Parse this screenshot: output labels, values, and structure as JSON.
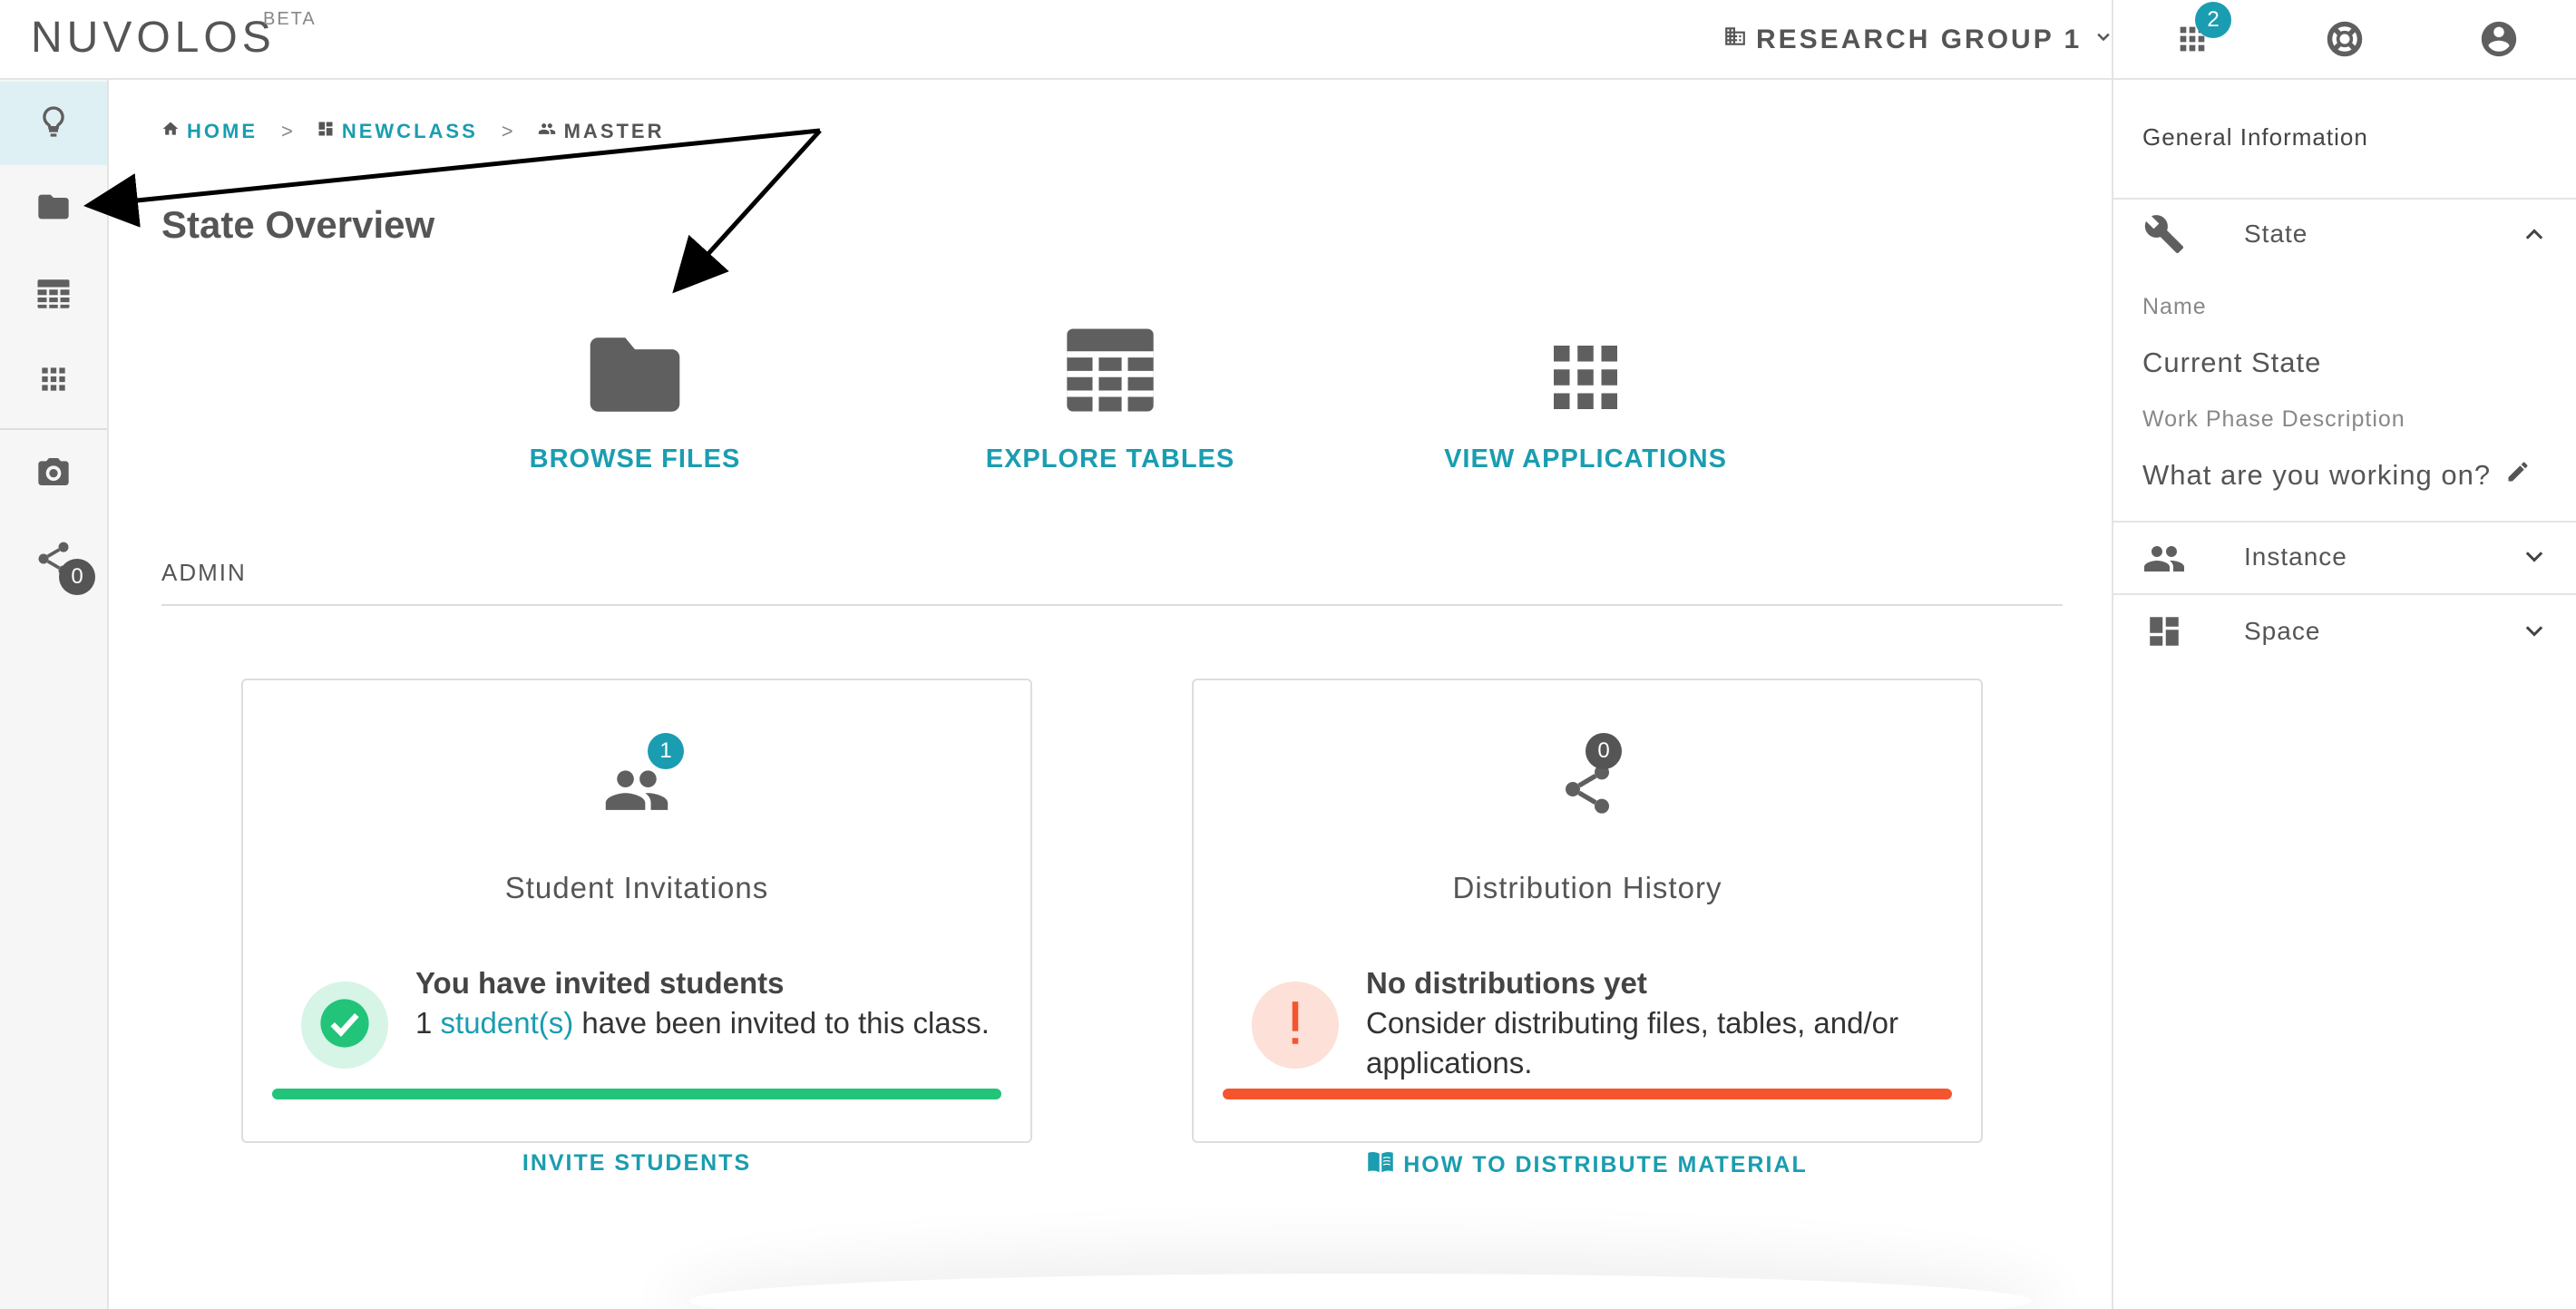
{
  "app": {
    "name": "NUVOLOS",
    "badge": "BETA"
  },
  "topbar": {
    "org_name": "RESEARCH GROUP 1",
    "apps_badge": "2",
    "icons": [
      "building-icon",
      "apps-grid-icon",
      "lifebuoy-icon",
      "account-circle-icon"
    ]
  },
  "sidebar": {
    "items": [
      {
        "icon": "lightbulb-icon",
        "active": true
      },
      {
        "icon": "folder-icon",
        "active": false
      },
      {
        "icon": "table-icon",
        "active": false
      },
      {
        "icon": "apps-grid-icon",
        "active": false
      },
      {
        "icon": "camera-icon",
        "active": false
      },
      {
        "icon": "share-icon",
        "active": false,
        "badge": "0"
      }
    ]
  },
  "breadcrumb": {
    "items": [
      {
        "label": "HOME",
        "icon": "home-icon"
      },
      {
        "label": "NEWCLASS",
        "icon": "space-icon"
      },
      {
        "label": "MASTER",
        "icon": "people-icon"
      }
    ],
    "separator": ">"
  },
  "main": {
    "title": "State Overview",
    "quick_links": [
      {
        "label": "BROWSE FILES",
        "icon": "folder-icon"
      },
      {
        "label": "EXPLORE TABLES",
        "icon": "table-icon"
      },
      {
        "label": "VIEW APPLICATIONS",
        "icon": "apps-grid-icon"
      }
    ],
    "admin_label": "ADMIN",
    "cards": [
      {
        "title": "Student Invitations",
        "badge": "1",
        "status_title": "You have invited students",
        "status_prefix": "1 ",
        "status_link": "student(s)",
        "status_suffix": " have been invited to this class.",
        "action": "INVITE STUDENTS",
        "status_color": "#22c47a"
      },
      {
        "title": "Distribution History",
        "badge": "0",
        "status_title": "No distributions yet",
        "status_text": "Consider distributing files, tables, and/or applications.",
        "action": "HOW TO DISTRIBUTE MATERIAL",
        "status_color": "#f4552f"
      }
    ]
  },
  "right_panel": {
    "header": "General Information",
    "sections": {
      "state": {
        "label": "State",
        "name_label": "Name",
        "name_value": "Current State",
        "desc_label": "Work Phase Description",
        "desc_value": "What are you working on?"
      },
      "instance": {
        "label": "Instance"
      },
      "space": {
        "label": "Space"
      }
    }
  },
  "colors": {
    "accent": "#1a9db0",
    "success": "#22c47a",
    "warning": "#f4552f",
    "icon_gray": "#5f5f5f"
  }
}
